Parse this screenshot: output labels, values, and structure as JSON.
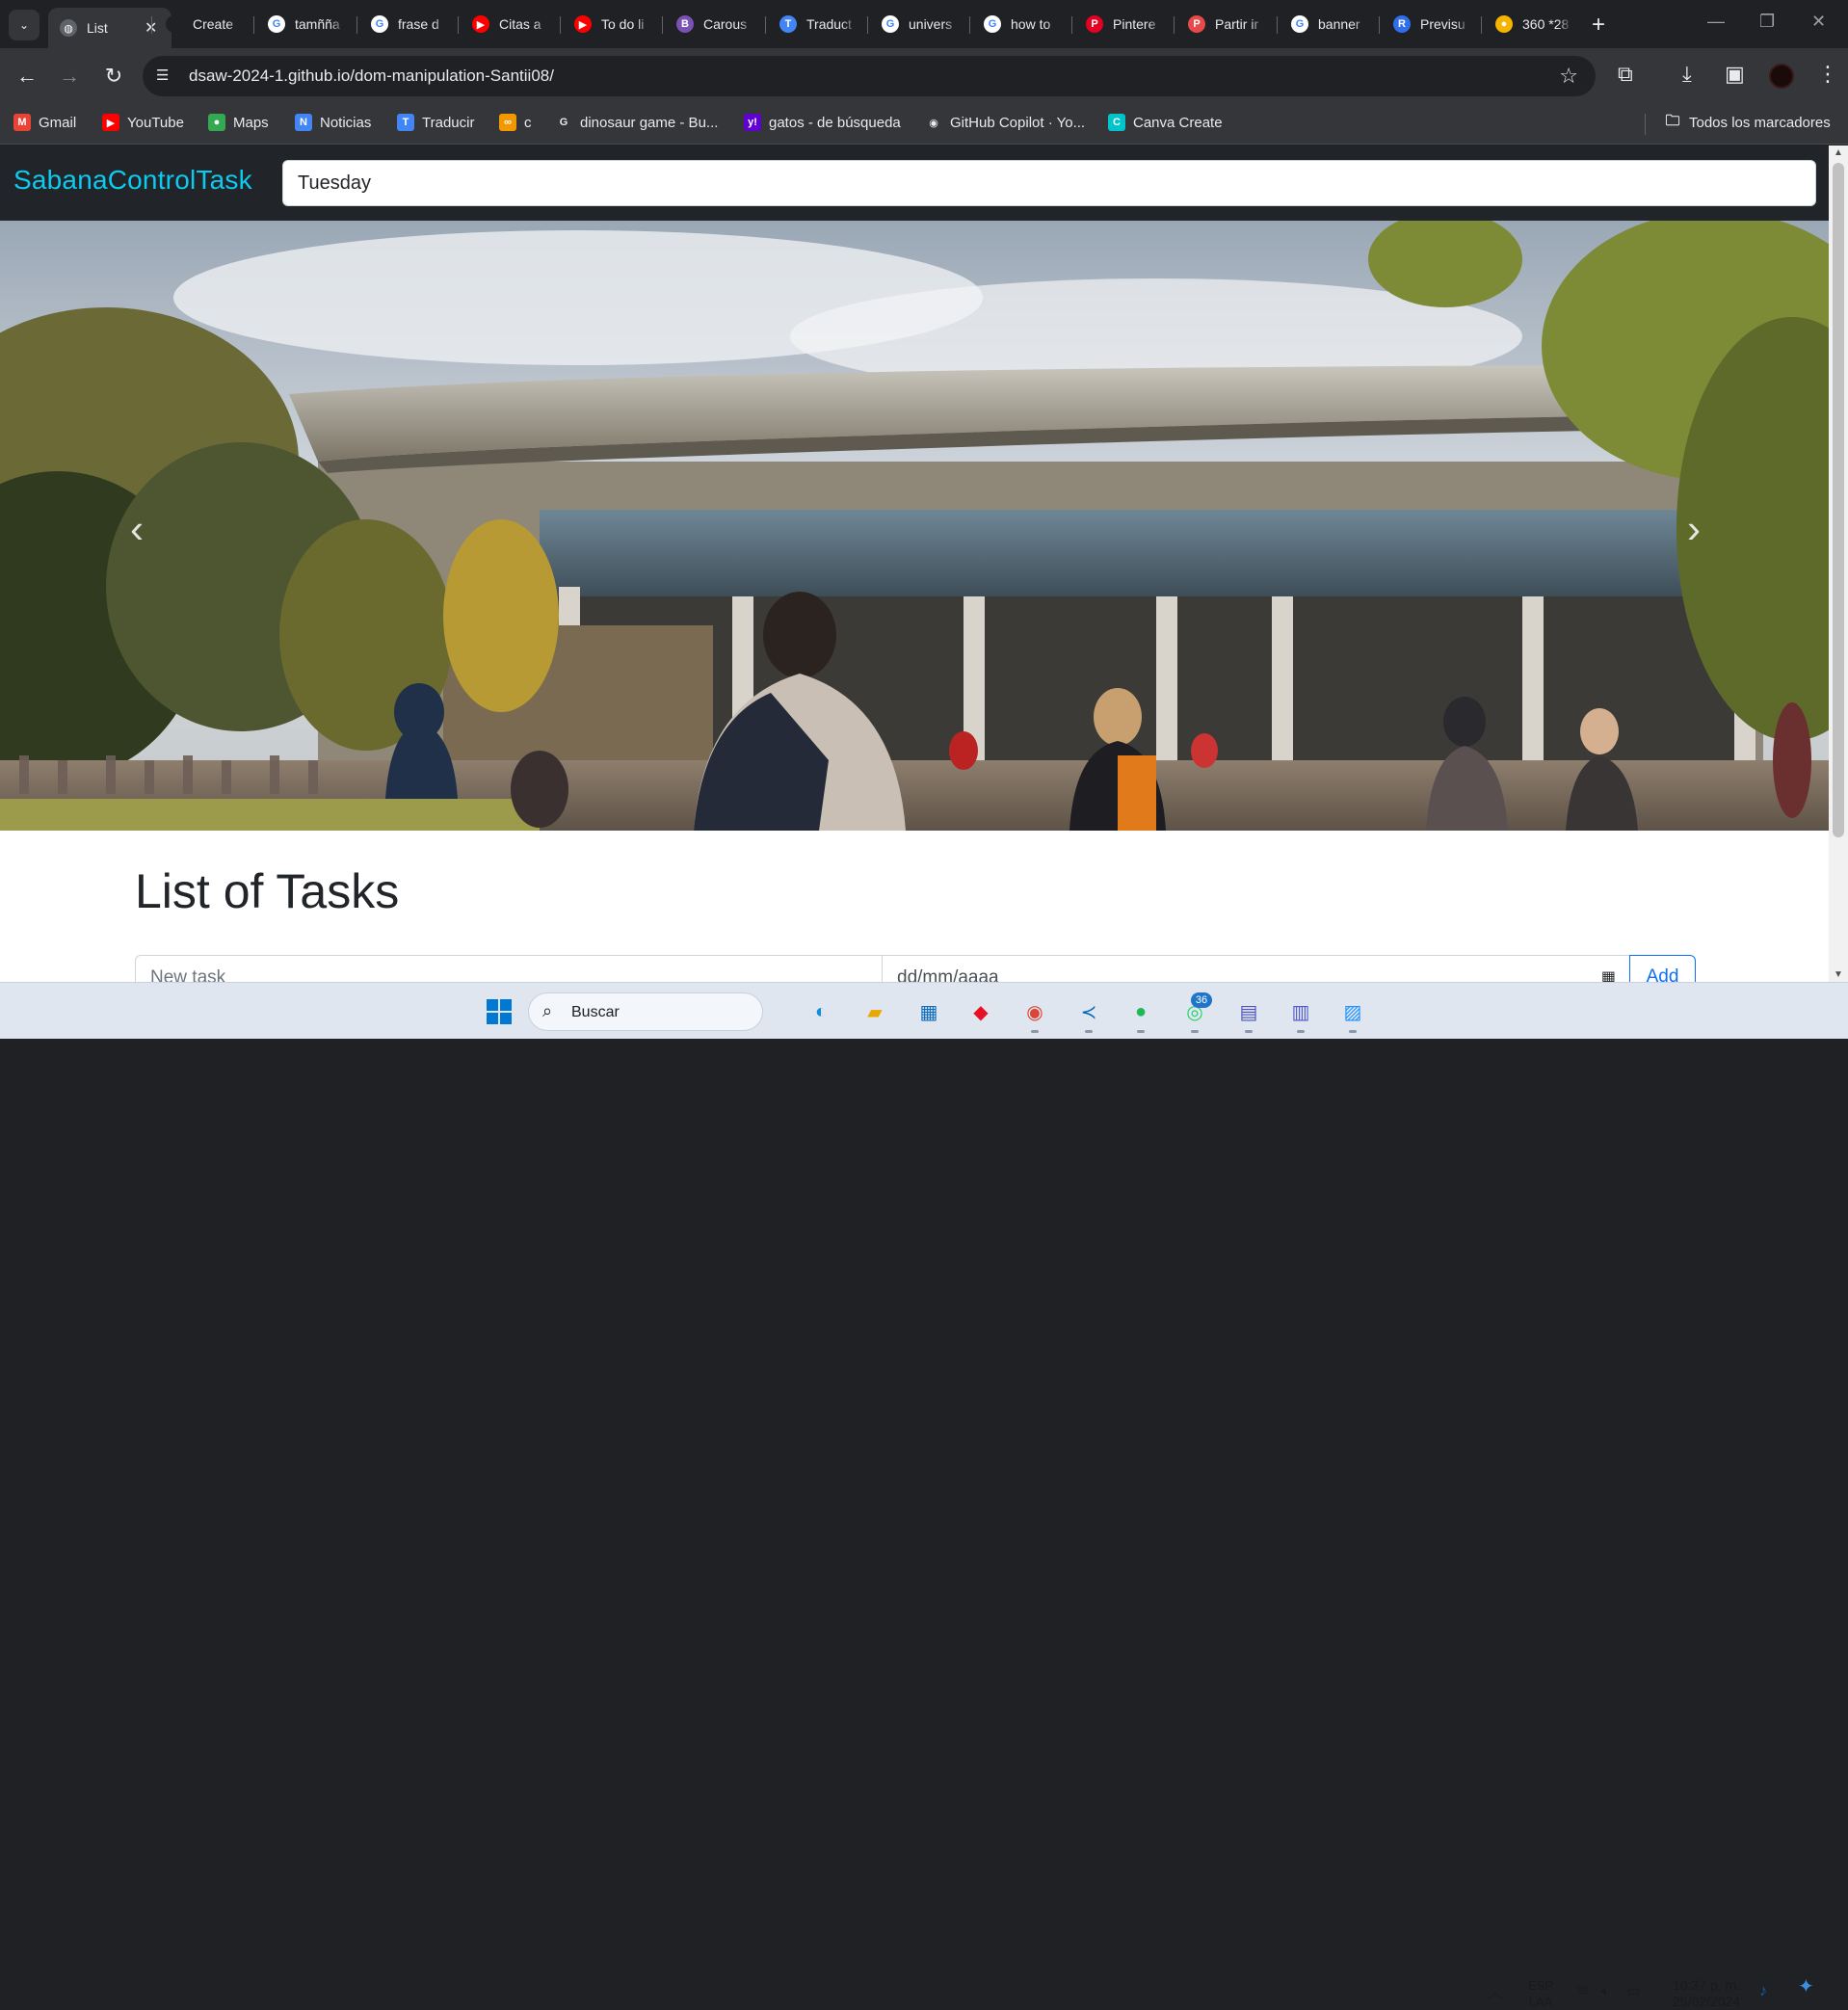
{
  "browser": {
    "tabs": [
      {
        "label": "List",
        "fav": "globe",
        "color": "#5f6368",
        "active": true
      },
      {
        "label": "Create",
        "fav": "blank",
        "color": "#202124"
      },
      {
        "label": "tamñña",
        "fav": "G",
        "color": "#ffffff"
      },
      {
        "label": "frase d",
        "fav": "G",
        "color": "#ffffff"
      },
      {
        "label": "Citas a",
        "fav": "yt",
        "color": "#ff0000"
      },
      {
        "label": "To do li",
        "fav": "yt",
        "color": "#ff0000"
      },
      {
        "label": "Carous",
        "fav": "B",
        "color": "#7952b3"
      },
      {
        "label": "Traduct",
        "fav": "tr",
        "color": "#4285f4"
      },
      {
        "label": "univers",
        "fav": "G",
        "color": "#ffffff"
      },
      {
        "label": "how to",
        "fav": "G",
        "color": "#ffffff"
      },
      {
        "label": "Pintere",
        "fav": "P",
        "color": "#e60023"
      },
      {
        "label": "Partir ir",
        "fav": "pt",
        "color": "#e84a4a"
      },
      {
        "label": "banner",
        "fav": "G",
        "color": "#ffffff"
      },
      {
        "label": "Previsu",
        "fav": "RP",
        "color": "#2f6feb"
      },
      {
        "label": "360 *28",
        "fav": "ch",
        "color": "#f4b400"
      }
    ],
    "url": "dsaw-2024-1.github.io/dom-manipulation-Santii08/",
    "bookmarks": [
      {
        "label": "Gmail",
        "color": "#ea4335",
        "glyph": "M"
      },
      {
        "label": "YouTube",
        "color": "#ff0000",
        "glyph": "▶"
      },
      {
        "label": "Maps",
        "color": "#34a853",
        "glyph": "●"
      },
      {
        "label": "Noticias",
        "color": "#4285f4",
        "glyph": "N"
      },
      {
        "label": "Traducir",
        "color": "#4285f4",
        "glyph": "T"
      },
      {
        "label": "c",
        "color": "#f29900",
        "glyph": "∞"
      },
      {
        "label": "dinosaur game - Bu...",
        "color": "#ffffff",
        "glyph": "G"
      },
      {
        "label": "gatos - de búsqueda",
        "color": "#6001d2",
        "glyph": "y!"
      },
      {
        "label": "GitHub Copilot · Yo...",
        "color": "#ffffff",
        "glyph": "◉"
      },
      {
        "label": "Canva Create",
        "color": "#00c4cc",
        "glyph": "C"
      }
    ],
    "all_bookmarks": "Todos los marcadores"
  },
  "app": {
    "brand": "SabanaControlTask",
    "day_value": "Tuesday",
    "list_title": "List of Tasks",
    "task_placeholder": "New task",
    "date_placeholder": "dd/mm/aaaa",
    "add_label": "Add",
    "brand_color": "#0dcaf0",
    "nav_bg": "#212529"
  },
  "taskbar": {
    "search_label": "Buscar",
    "lang_top": "ESP",
    "lang_bottom": "LAA",
    "time": "10:37 p. m.",
    "date": "25/02/2024",
    "whatsapp_badge": "36"
  }
}
